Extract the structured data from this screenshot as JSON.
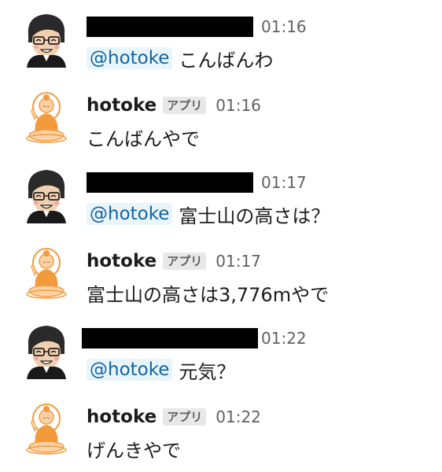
{
  "messages": [
    {
      "type": "user",
      "avatar_icon": "user-avatar-icon",
      "sender_redacted": true,
      "time": "01:16",
      "mention": "@hotoke",
      "text": "こんばんわ"
    },
    {
      "type": "bot",
      "avatar_icon": "buddha-avatar-icon",
      "sender": "hotoke",
      "badge": "アプリ",
      "time": "01:16",
      "text": "こんばんやで"
    },
    {
      "type": "user",
      "avatar_icon": "user-avatar-icon",
      "sender_redacted": true,
      "time": "01:17",
      "mention": "@hotoke",
      "text": "富士山の高さは？"
    },
    {
      "type": "bot",
      "avatar_icon": "buddha-avatar-icon",
      "sender": "hotoke",
      "badge": "アプリ",
      "time": "01:17",
      "text": "富士山の高さは3,776mやで"
    },
    {
      "type": "user",
      "avatar_icon": "user-avatar-icon",
      "sender_redacted": true,
      "time": "01:22",
      "mention": "@hotoke",
      "text": "元気？"
    },
    {
      "type": "bot",
      "avatar_icon": "buddha-avatar-icon",
      "sender": "hotoke",
      "badge": "アプリ",
      "time": "01:22",
      "text": "げんきやで"
    }
  ],
  "colors": {
    "mention_bg": "#e8f5fa",
    "mention_text": "#1264a3",
    "badge_bg": "#e8e8e8",
    "timestamp": "#616061",
    "buddha_orange": "#f39a3c"
  }
}
